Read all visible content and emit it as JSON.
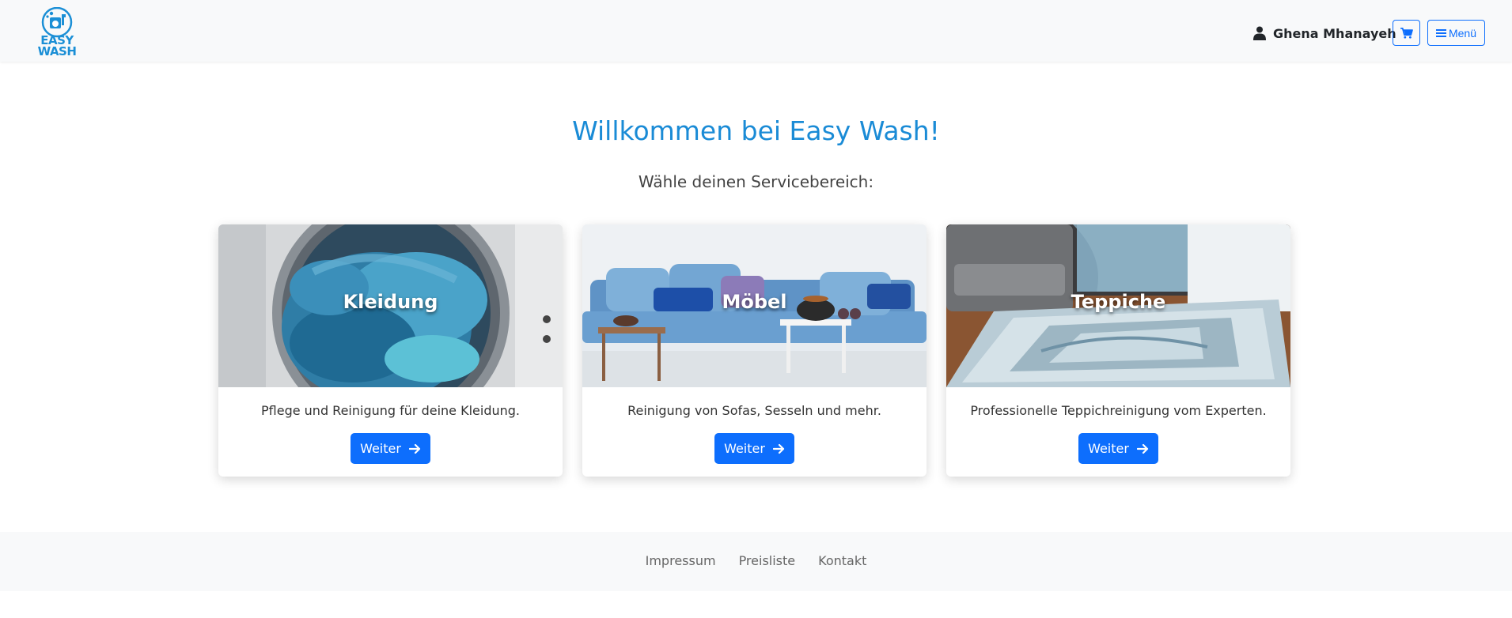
{
  "header": {
    "logo_text_line1": "EASY",
    "logo_text_line2": "WASH",
    "user_name": "Ghena Mhanayeh",
    "menu_label": "Menü",
    "icons": {
      "user": "user-icon",
      "cart": "cart-icon",
      "menu": "hamburger-icon"
    }
  },
  "main": {
    "title": "Willkommen bei Easy Wash!",
    "subtitle": "Wähle deinen Servicebereich:",
    "cards": [
      {
        "label": "Kleidung",
        "description": "Pflege und Reinigung für deine Kleidung.",
        "button": "Weiter"
      },
      {
        "label": "Möbel",
        "description": "Reinigung von Sofas, Sesseln und mehr.",
        "button": "Weiter"
      },
      {
        "label": "Teppiche",
        "description": "Professionelle Teppichreinigung vom Experten.",
        "button": "Weiter"
      }
    ]
  },
  "footer": {
    "links": [
      "Impressum",
      "Preisliste",
      "Kontakt"
    ]
  },
  "colors": {
    "brand": "#1a8bd6",
    "primary": "#0d6efd",
    "navbar_bg": "#f8f9fa"
  }
}
